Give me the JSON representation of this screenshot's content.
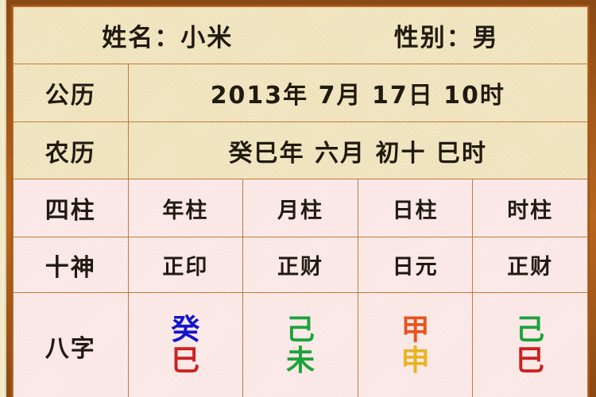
{
  "header": {
    "name_label": "姓名：小米",
    "gender_label": "性别：男"
  },
  "rows": {
    "solar": {
      "label": "公历",
      "value": "2013年 7月 17日 10时"
    },
    "lunar": {
      "label": "农历",
      "value": "癸巳年 六月 初十 巳时"
    },
    "pillars": {
      "label": "四柱",
      "cells": [
        "年柱",
        "月柱",
        "日柱",
        "时柱"
      ]
    },
    "ten_gods": {
      "label": "十神",
      "cells": [
        "正印",
        "正财",
        "日元",
        "正财"
      ]
    },
    "eight_chars": {
      "label": "八字",
      "cells": [
        {
          "gan": "癸",
          "gan_color": "#1414cc",
          "zhi": "巳",
          "zhi_color": "#cc2020"
        },
        {
          "gan": "己",
          "gan_color": "#1ca33c",
          "zhi": "未",
          "zhi_color": "#1ca33c"
        },
        {
          "gan": "甲",
          "gan_color": "#e8541f",
          "zhi": "申",
          "zhi_color": "#e8b420"
        },
        {
          "gan": "己",
          "gan_color": "#1ca33c",
          "zhi": "巳",
          "zhi_color": "#cc2020"
        }
      ]
    }
  },
  "theme": {
    "frame_color": "#a8561a",
    "grid_color": "#c07a3a",
    "tan_bg": "#f1e5bd",
    "pink_bg": "#fbe8e6",
    "text_color": "#211a10"
  }
}
